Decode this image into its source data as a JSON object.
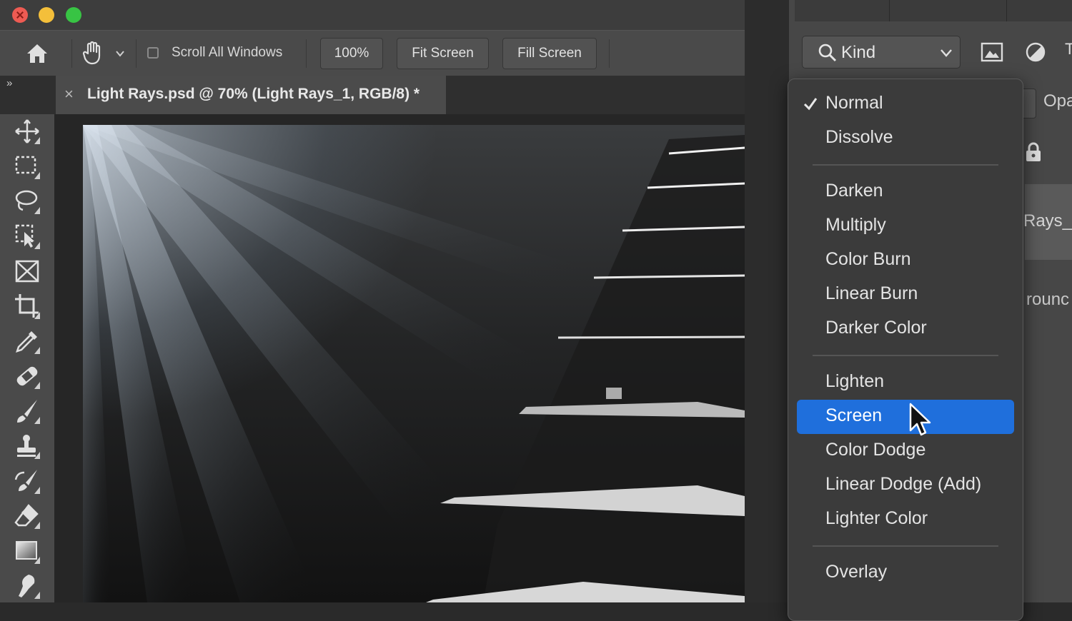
{
  "window": {
    "controls": [
      "close",
      "minimize",
      "zoom"
    ]
  },
  "options_bar": {
    "home_icon": "home-icon",
    "tool_icon": "hand-icon",
    "scroll_all_windows": {
      "label": "Scroll All Windows",
      "checked": false
    },
    "buttons": [
      "100%",
      "Fit Screen",
      "Fill Screen"
    ]
  },
  "document_tab": {
    "close": "×",
    "title": "Light Rays.psd @ 70% (Light Rays_1, RGB/8) *"
  },
  "panel_collapse": "»",
  "toolbar": {
    "tools": [
      "move-tool-icon",
      "marquee-tool-icon",
      "lasso-tool-icon",
      "object-select-tool-icon",
      "frame-tool-icon",
      "crop-tool-icon",
      "eyedropper-tool-icon",
      "healing-brush-tool-icon",
      "brush-tool-icon",
      "clone-stamp-tool-icon",
      "history-brush-tool-icon",
      "eraser-tool-icon",
      "gradient-tool-icon",
      "smudge-tool-icon"
    ]
  },
  "layers_panel": {
    "filter_kind": "Kind",
    "opacity_label": "Opa",
    "layer_name_partial": "Rays_",
    "background_partial": "rounc"
  },
  "blend_menu": {
    "selected": "Screen",
    "checked": "Normal",
    "groups": [
      [
        "Normal",
        "Dissolve"
      ],
      [
        "Darken",
        "Multiply",
        "Color Burn",
        "Linear Burn",
        "Darker Color"
      ],
      [
        "Lighten",
        "Screen",
        "Color Dodge",
        "Linear Dodge (Add)",
        "Lighter Color"
      ],
      [
        "Overlay"
      ]
    ]
  },
  "colors": {
    "accent": "#1f6fdc",
    "panel": "#474747",
    "menu": "#3b3b3b"
  }
}
